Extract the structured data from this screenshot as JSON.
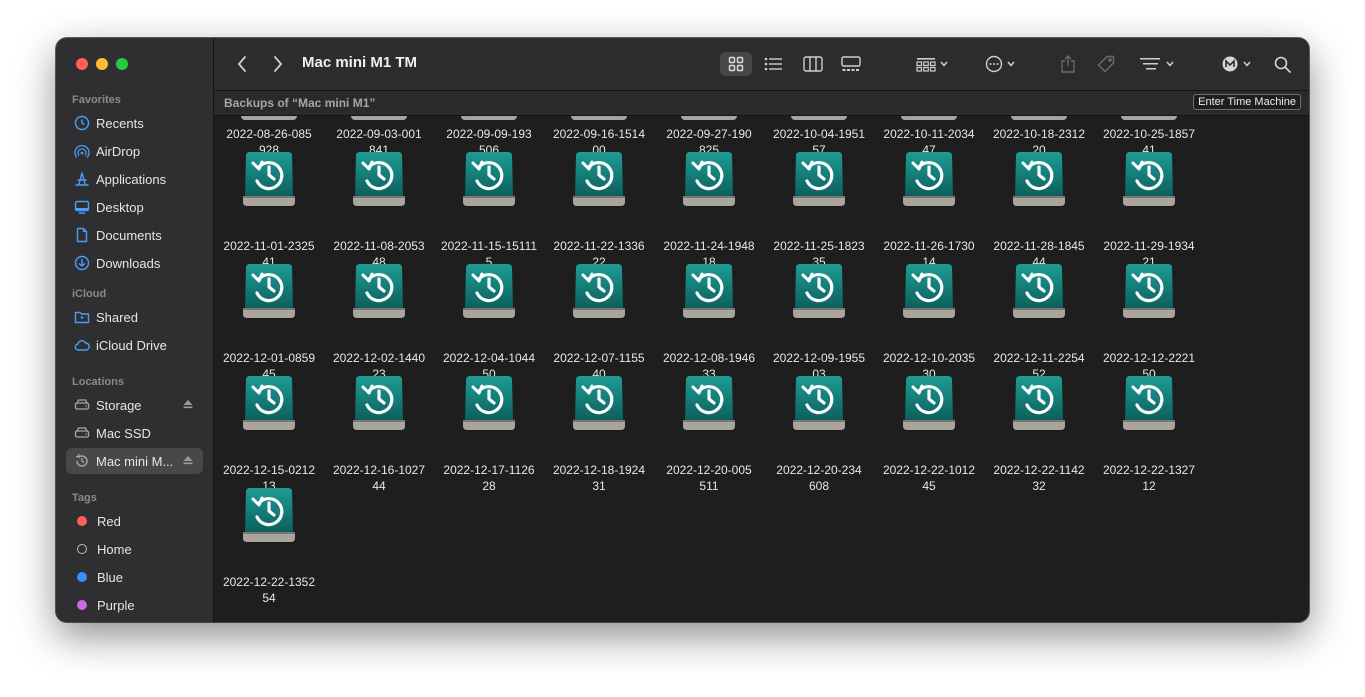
{
  "window": {
    "title": "Mac mini M1 TM"
  },
  "sidebar": {
    "sections": [
      {
        "title": "Favorites",
        "items": [
          {
            "label": "Recents",
            "icon": "clock-icon"
          },
          {
            "label": "AirDrop",
            "icon": "airdrop-icon"
          },
          {
            "label": "Applications",
            "icon": "applications-icon"
          },
          {
            "label": "Desktop",
            "icon": "desktop-icon"
          },
          {
            "label": "Documents",
            "icon": "document-icon"
          },
          {
            "label": "Downloads",
            "icon": "downloads-icon"
          }
        ]
      },
      {
        "title": "iCloud",
        "items": [
          {
            "label": "Shared",
            "icon": "shared-folder-icon"
          },
          {
            "label": "iCloud Drive",
            "icon": "cloud-icon"
          }
        ]
      },
      {
        "title": "Locations",
        "items": [
          {
            "label": "Storage",
            "icon": "drive-icon",
            "eject": true
          },
          {
            "label": "Mac SSD",
            "icon": "drive-icon"
          },
          {
            "label": "Mac mini M...",
            "icon": "time-machine-icon",
            "eject": true,
            "active": true
          }
        ]
      },
      {
        "title": "Tags",
        "items": [
          {
            "label": "Red",
            "color": "#fe5f57"
          },
          {
            "label": "Home",
            "color": ""
          },
          {
            "label": "Blue",
            "color": "#3a8ff7"
          },
          {
            "label": "Purple",
            "color": "#c86ce0"
          }
        ]
      }
    ]
  },
  "pathbar": {
    "label": "Backups of “Mac mini M1”",
    "button": "Enter Time Machine"
  },
  "backups": [
    [
      "2022-08-26-085",
      "928"
    ],
    [
      "2022-09-03-001",
      "841"
    ],
    [
      "2022-09-09-193",
      "506"
    ],
    [
      "2022-09-16-1514",
      "00"
    ],
    [
      "2022-09-27-190",
      "825"
    ],
    [
      "2022-10-04-1951",
      "57"
    ],
    [
      "2022-10-11-2034",
      "47"
    ],
    [
      "2022-10-18-2312",
      "20"
    ],
    [
      "2022-10-25-1857",
      "41"
    ],
    [
      "2022-11-01-2325",
      "41"
    ],
    [
      "2022-11-08-2053",
      "48"
    ],
    [
      "2022-11-15-15111",
      "5"
    ],
    [
      "2022-11-22-1336",
      "22"
    ],
    [
      "2022-11-24-1948",
      "18"
    ],
    [
      "2022-11-25-1823",
      "35"
    ],
    [
      "2022-11-26-1730",
      "14"
    ],
    [
      "2022-11-28-1845",
      "44"
    ],
    [
      "2022-11-29-1934",
      "21"
    ],
    [
      "2022-12-01-0859",
      "45"
    ],
    [
      "2022-12-02-1440",
      "23"
    ],
    [
      "2022-12-04-1044",
      "50"
    ],
    [
      "2022-12-07-1155",
      "40"
    ],
    [
      "2022-12-08-1946",
      "33"
    ],
    [
      "2022-12-09-1955",
      "03"
    ],
    [
      "2022-12-10-2035",
      "30"
    ],
    [
      "2022-12-11-2254",
      "52"
    ],
    [
      "2022-12-12-2221",
      "50"
    ],
    [
      "2022-12-15-0212",
      "13"
    ],
    [
      "2022-12-16-1027",
      "44"
    ],
    [
      "2022-12-17-1126",
      "28"
    ],
    [
      "2022-12-18-1924",
      "31"
    ],
    [
      "2022-12-20-005",
      "511"
    ],
    [
      "2022-12-20-234",
      "608"
    ],
    [
      "2022-12-22-1012",
      "45"
    ],
    [
      "2022-12-22-1142",
      "32"
    ],
    [
      "2022-12-22-1327",
      "12"
    ],
    [
      "2022-12-22-1352",
      "54"
    ]
  ]
}
